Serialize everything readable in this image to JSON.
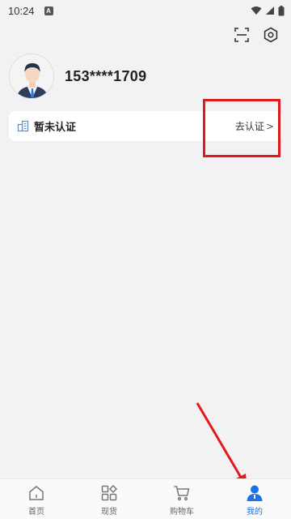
{
  "status_bar": {
    "time": "10:24",
    "notification_letter": "A"
  },
  "profile": {
    "phone": "153****1709"
  },
  "certification": {
    "label": "暂未认证",
    "action": "去认证",
    "arrow": ">"
  },
  "nav": {
    "items": [
      {
        "label": "首页",
        "icon": "home-icon"
      },
      {
        "label": "现货",
        "icon": "grid-icon"
      },
      {
        "label": "购物车",
        "icon": "cart-icon"
      },
      {
        "label": "我的",
        "icon": "user-icon",
        "active": true
      }
    ]
  },
  "colors": {
    "accent": "#1a73e8",
    "annotation": "#e01a1a",
    "background": "#f2f2f4"
  }
}
